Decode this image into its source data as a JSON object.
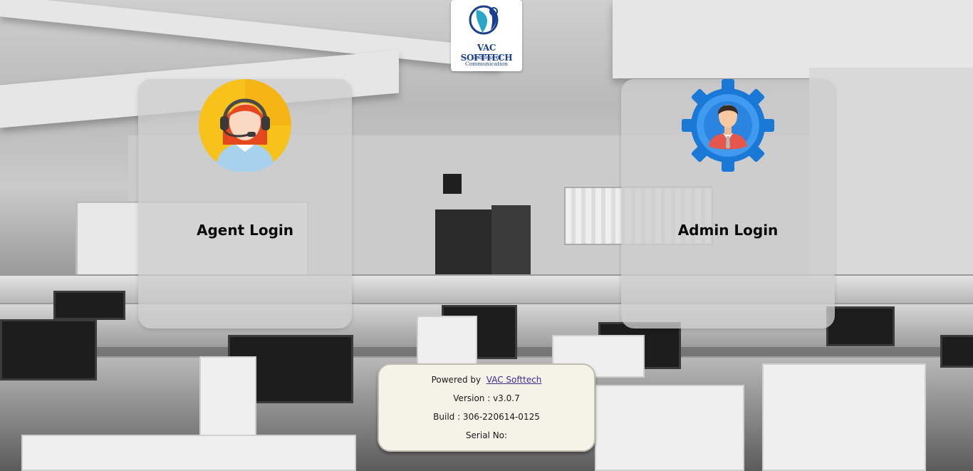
{
  "logo": {
    "title": "VAC SOFTTECH",
    "subtitle": "Goddess of Communication",
    "colors": {
      "primary": "#1b3f8f",
      "accent": "#2aa6c9"
    }
  },
  "cards": [
    {
      "label": "Agent Login",
      "icon": "call-center-agent-icon"
    },
    {
      "label": "Admin Login",
      "icon": "admin-gear-user-icon"
    }
  ],
  "info": {
    "powered_by_label": "Powered by",
    "powered_by_link": "VAC Softtech",
    "version": "Version : v3.0.7",
    "build": "Build : 306-220614-0125",
    "serial": "Serial No:"
  }
}
